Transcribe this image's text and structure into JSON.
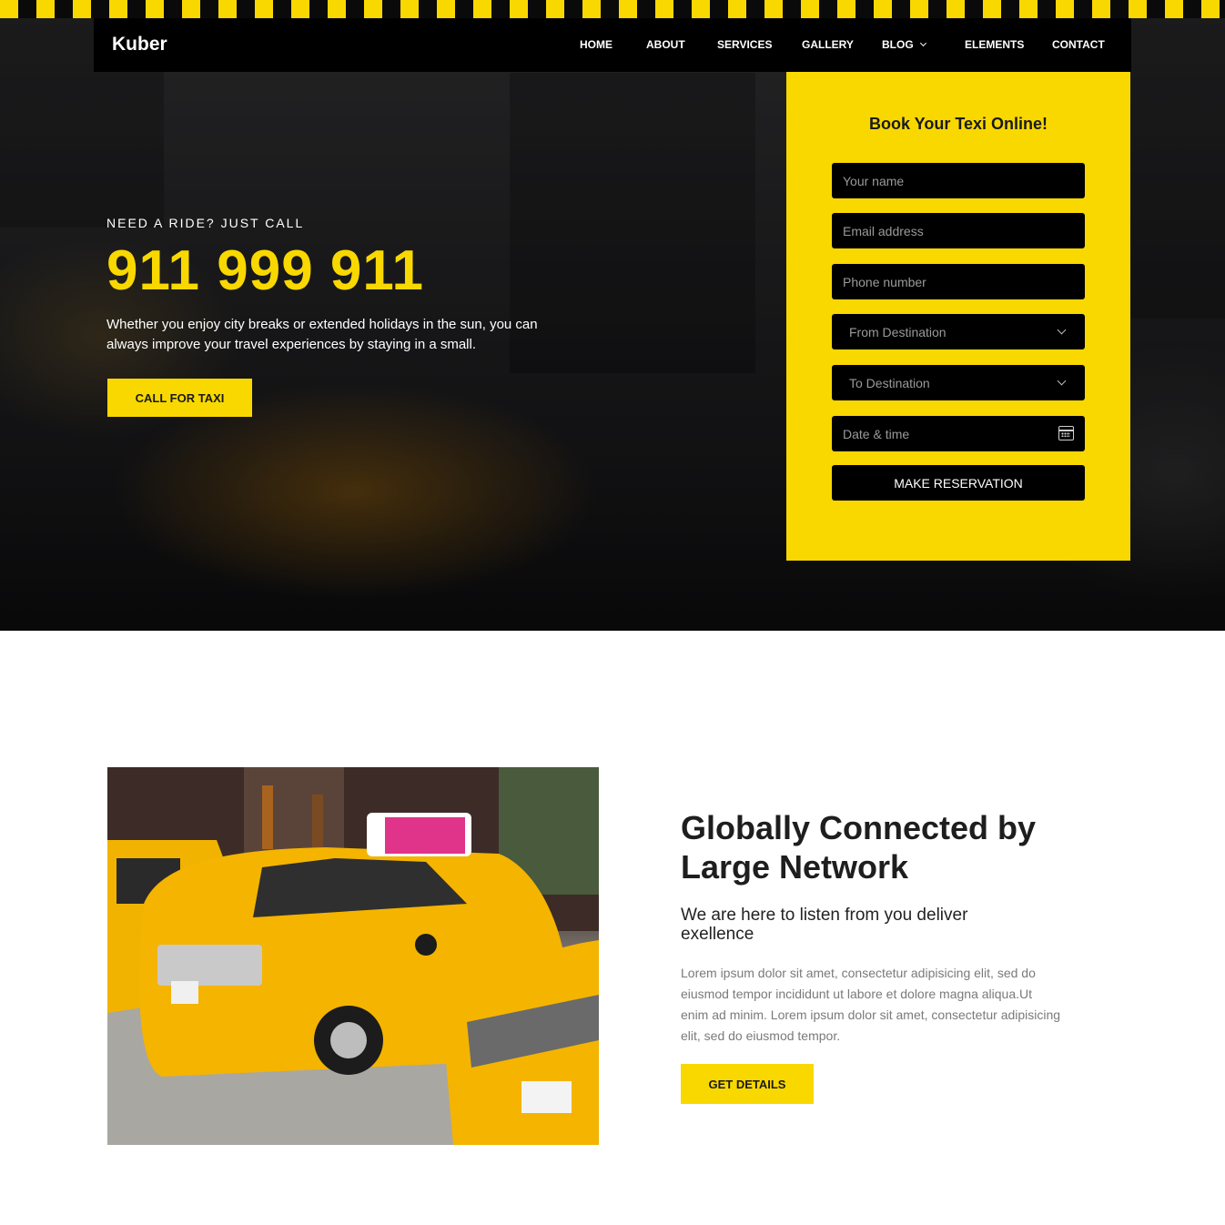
{
  "brand": {
    "logo": "Kuber",
    "accent_color": "#f9d800",
    "dark_color": "#000000"
  },
  "nav": {
    "items": [
      {
        "label": "HOME"
      },
      {
        "label": "ABOUT"
      },
      {
        "label": "SERVICES"
      },
      {
        "label": "GALLERY"
      },
      {
        "label": "BLOG",
        "icon": "chevron-down-icon"
      },
      {
        "label": "ELEMENTS"
      },
      {
        "label": "CONTACT"
      }
    ]
  },
  "hero": {
    "kicker": "NEED A RIDE? JUST CALL",
    "phone": "911 999 911",
    "description": "Whether you enjoy city breaks or extended holidays in the sun, you can always improve your travel experiences by staying in a small.",
    "cta_label": "CALL FOR TAXI"
  },
  "booking": {
    "title": "Book Your Texi Online!",
    "name_placeholder": "Your name",
    "email_placeholder": "Email address",
    "phone_placeholder": "Phone number",
    "from_selected": "From Destination",
    "to_selected": "To Destination",
    "datetime_placeholder": "Date & time",
    "datetime_icon": "calendar-icon",
    "submit_label": "MAKE RESERVATION"
  },
  "about": {
    "title": "Globally Connected by Large Network",
    "subtitle": "We are here to listen from you deliver exellence",
    "body": "Lorem ipsum dolor sit amet, consectetur adipisicing elit, sed do eiusmod tempor incididunt ut labore et dolore magna aliqua.Ut enim ad minim. Lorem ipsum dolor sit amet, consectetur adipisicing elit, sed do eiusmod tempor.",
    "cta_label": "GET DETAILS"
  }
}
